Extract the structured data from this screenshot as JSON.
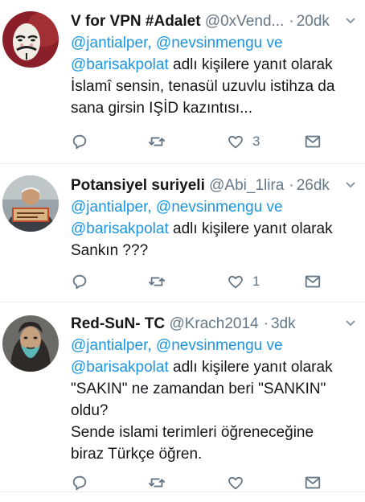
{
  "reply_prefix": "adlı kişilere yanıt olarak",
  "tweets": [
    {
      "name": "V for VPN #Adalet",
      "handle": "@0xVend...",
      "time": "20dk",
      "mention1": "@jantialper,",
      "mention2": "@nevsinmengu",
      "connector": "ve",
      "mention3": "@barisakpolat",
      "text_lines": [
        "İslamî sensin, tenasül uzuvlu istihza da",
        "sana girsin IŞİD kazıntısı..."
      ],
      "likes": "3",
      "avatar": "guy-fawkes-mask"
    },
    {
      "name": "Potansiyel suriyeli",
      "handle": "@Abi_1lira",
      "time": "26dk",
      "mention1": "@jantialper,",
      "mention2": "@nevsinmengu",
      "connector": "ve",
      "mention3": "@barisakpolat",
      "text_lines": [
        "Sankın ???"
      ],
      "likes": "1",
      "avatar": "man-with-sign"
    },
    {
      "name": "Red-SuN- TC",
      "handle": "@Krach2014",
      "time": "3dk",
      "mention1": "@jantialper,",
      "mention2": "@nevsinmengu",
      "connector": "ve",
      "mention3": "@barisakpolat",
      "text_lines": [
        "\"SAKIN\" ne zamandan beri \"SANKIN\"",
        "oldu?",
        "Sende islami terimleri öğreneceğine",
        "biraz Türkçe öğren."
      ],
      "likes": "",
      "avatar": "bearded-man"
    }
  ],
  "icons": [
    "reply-icon",
    "retweet-icon",
    "like-icon",
    "direct-message-icon",
    "chevron-down-icon"
  ],
  "colors": {
    "mention": "#1b95e0",
    "secondary": "#657786",
    "divider": "#e6ecf0"
  }
}
